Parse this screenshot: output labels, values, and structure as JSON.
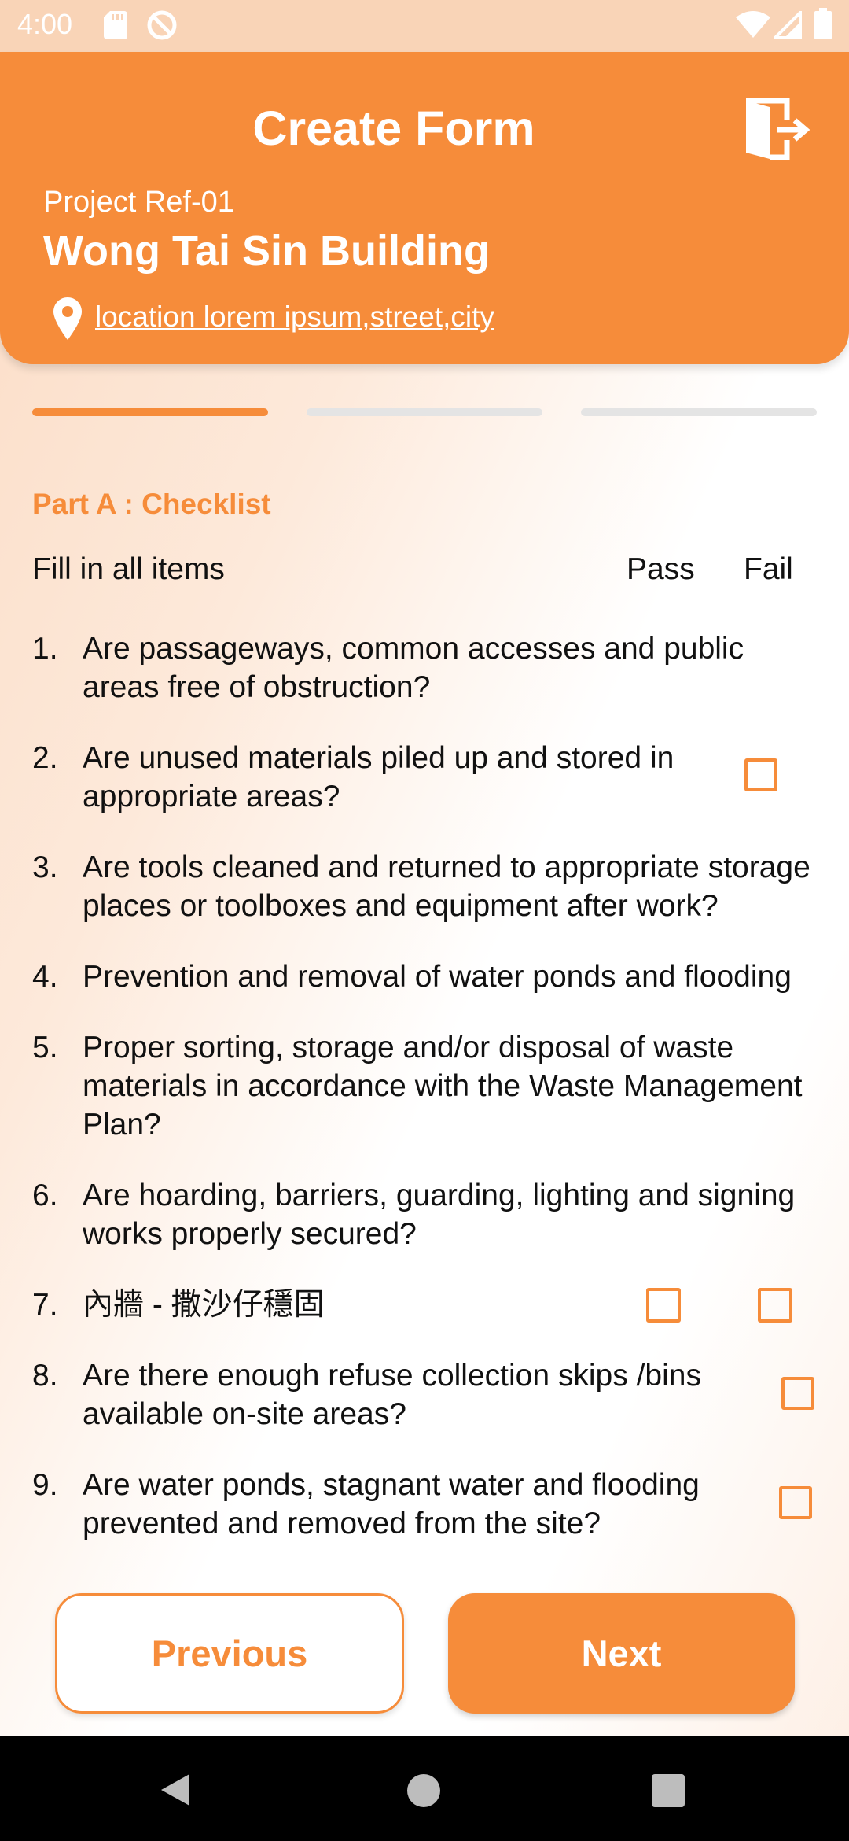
{
  "status_bar": {
    "time": "4:00",
    "icons": [
      "sd-card-icon",
      "do-not-disturb-icon",
      "wifi-icon",
      "signal-icon",
      "battery-icon"
    ]
  },
  "header": {
    "title": "Create Form",
    "project_ref": "Project Ref-01",
    "project_name": "Wong Tai Sin Building",
    "location": "location lorem ipsum,street,city",
    "exit_icon": "exit-icon"
  },
  "stepper": {
    "total_steps": 3,
    "current_step": 1
  },
  "checklist": {
    "section_title": "Part A : Checklist",
    "header_label": "Fill in all items",
    "pass_label": "Pass",
    "fail_label": "Fail",
    "items": [
      {
        "num": "1.",
        "line1": "Are passageways, common accesses and public",
        "line2": "areas free of obstruction?"
      },
      {
        "num": "2.",
        "line1": "Are unused materials piled up and stored in",
        "line2": "appropriate areas?"
      },
      {
        "num": "3.",
        "line1": "Are tools cleaned and returned to appropriate storage",
        "line2": "places or toolboxes and equipment after work?"
      },
      {
        "num": "4.",
        "line1": "Prevention and removal of water ponds and flooding"
      },
      {
        "num": "5.",
        "line1": "Proper sorting, storage and/or disposal of waste",
        "line2": "materials in accordance with the Waste Management",
        "line3": "Plan?"
      },
      {
        "num": "6.",
        "line1": "Are hoarding, barriers, guarding, lighting and signing",
        "line2": "works properly secured?"
      },
      {
        "num": "7.",
        "line1": "內牆 - 撒沙仔穩固"
      },
      {
        "num": "8.",
        "line1": "Are there enough refuse collection skips /bins",
        "line2": "available on-site areas?"
      },
      {
        "num": "9.",
        "line1": "Are water ponds, stagnant water and flooding",
        "line2": "prevented and removed from the site?"
      }
    ]
  },
  "buttons": {
    "previous": "Previous",
    "next": "Next"
  },
  "colors": {
    "accent": "#f68c3a",
    "status_bar": "#f9d4b7",
    "nav_bar": "#000000"
  }
}
